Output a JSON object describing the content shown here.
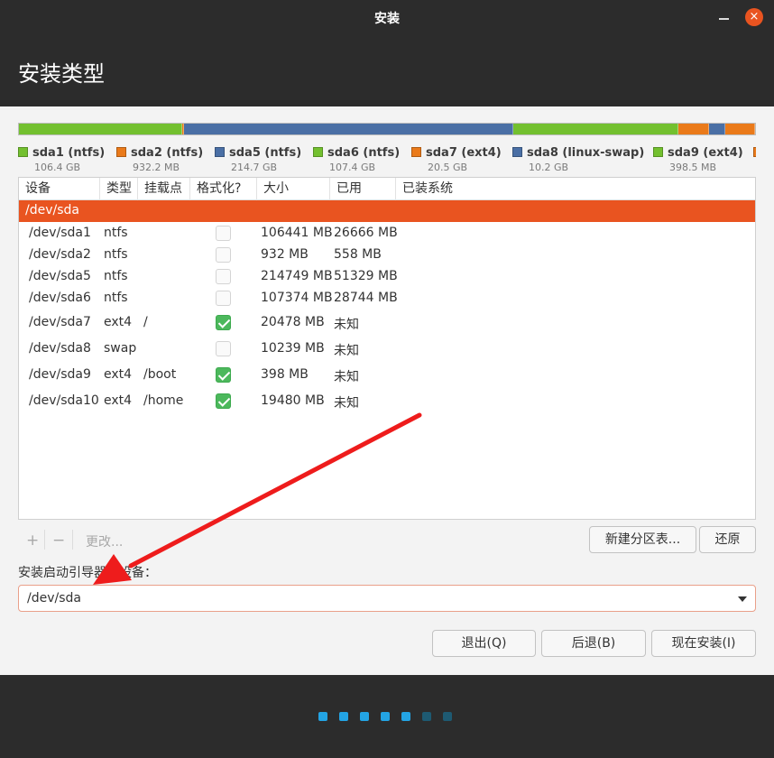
{
  "window": {
    "title": "安装",
    "close_glyph": "×"
  },
  "header": {
    "title": "安装类型"
  },
  "colors": {
    "ntfs": "#73c02f",
    "ext4": "#ea7a1a",
    "swap": "#4a6fa5",
    "selection": "#e95420",
    "dot_active": "#23a4e4",
    "dot_inactive": "#1e5a72",
    "check_on": "#4cb85c"
  },
  "partitions_legend": [
    {
      "name": "sda1 (ntfs)",
      "size": "106.4 GB",
      "fs": "ntfs"
    },
    {
      "name": "sda2 (ntfs)",
      "size": "932.2 MB",
      "fs": "ext4"
    },
    {
      "name": "sda5 (ntfs)",
      "size": "214.7 GB",
      "fs": "swap"
    },
    {
      "name": "sda6 (ntfs)",
      "size": "107.4 GB",
      "fs": "ntfs"
    },
    {
      "name": "sda7 (ext4)",
      "size": "20.5 GB",
      "fs": "ext4"
    },
    {
      "name": "sda8 (linux-swap)",
      "size": "10.2 GB",
      "fs": "swap"
    },
    {
      "name": "sda9 (ext4)",
      "size": "398.5 MB",
      "fs": "ntfs"
    }
  ],
  "table": {
    "headers": [
      "设备",
      "类型",
      "挂载点",
      "格式化?",
      "大小",
      "已用",
      "已装系统"
    ],
    "disk": "/dev/sda",
    "rows": [
      {
        "device": "/dev/sda1",
        "type": "ntfs",
        "mount": "",
        "format": false,
        "size": "106441 MB",
        "used": "26666 MB"
      },
      {
        "device": "/dev/sda2",
        "type": "ntfs",
        "mount": "",
        "format": false,
        "size": "932 MB",
        "used": "558 MB"
      },
      {
        "device": "/dev/sda5",
        "type": "ntfs",
        "mount": "",
        "format": false,
        "size": "214749 MB",
        "used": "51329 MB"
      },
      {
        "device": "/dev/sda6",
        "type": "ntfs",
        "mount": "",
        "format": false,
        "size": "107374 MB",
        "used": "28744 MB"
      },
      {
        "device": "/dev/sda7",
        "type": "ext4",
        "mount": "/",
        "format": true,
        "size": "20478 MB",
        "used": "未知"
      },
      {
        "device": "/dev/sda8",
        "type": "swap",
        "mount": "",
        "format": false,
        "size": "10239 MB",
        "used": "未知"
      },
      {
        "device": "/dev/sda9",
        "type": "ext4",
        "mount": "/boot",
        "format": true,
        "size": "398 MB",
        "used": "未知"
      },
      {
        "device": "/dev/sda10",
        "type": "ext4",
        "mount": "/home",
        "format": true,
        "size": "19480 MB",
        "used": "未知"
      }
    ]
  },
  "toolbar": {
    "add": "+",
    "remove": "−",
    "change": "更改...",
    "new_table": "新建分区表...",
    "revert": "还原"
  },
  "bootloader": {
    "label": "安装启动引导器的设备：",
    "value": "/dev/sda"
  },
  "buttons": {
    "quit": "退出(Q)",
    "back": "后退(B)",
    "install": "现在安装(I)"
  },
  "progress": {
    "total_steps": 7,
    "active_steps": 5
  }
}
